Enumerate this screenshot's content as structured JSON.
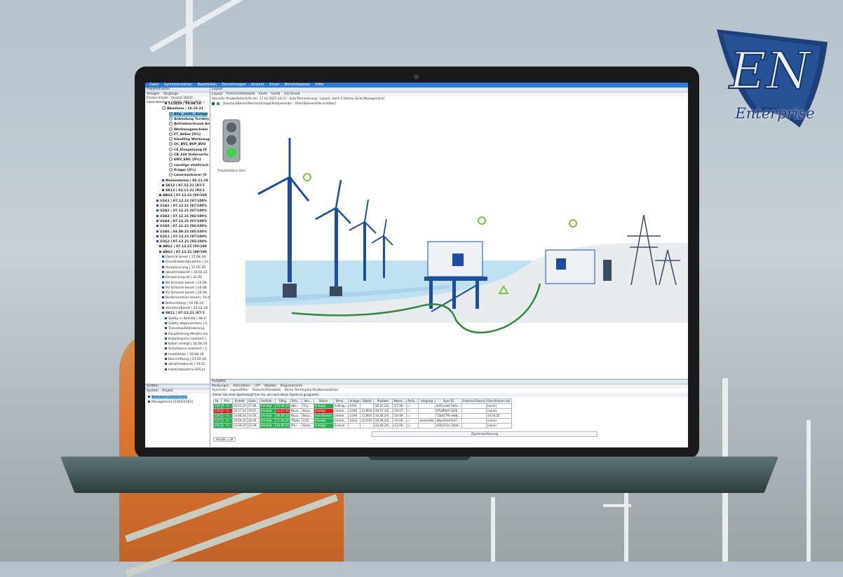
{
  "brand": {
    "logo_text": "Enterprise",
    "logo_mark": "EN",
    "colors": {
      "primary": "#1a3f7c",
      "menubar": "#2b7ed8",
      "ok": "#22b44a",
      "bad": "#e21c1c"
    }
  },
  "menu": [
    "Datei",
    "Synchronisation",
    "Bearbeiten",
    "Einstellungen",
    "Ansicht",
    "Email",
    "Berichtswesen",
    "Hilfe"
  ],
  "left": {
    "title": "Projektstruktur",
    "tabs": [
      "Anlagen",
      "Vorgänge"
    ],
    "info": "Einstes Anzahl - Gesamt:28522...",
    "path": "Inbetriebnahme | U1A2 | ABG1 | SK11 |",
    "tree": [
      {
        "t": "111820 | 16.08.18",
        "i": 28,
        "b": true,
        "k": "sq"
      },
      {
        "t": "Abnahme | 16.10.21",
        "i": 24,
        "b": true,
        "k": "circ"
      },
      {
        "t": "Allg._sicht._Anlage",
        "i": 34,
        "b": true,
        "k": "circ",
        "sel": true
      },
      {
        "t": "Anbindung Turnkey",
        "i": 34,
        "b": true,
        "k": "circ"
      },
      {
        "t": "Antriebsschrank An",
        "i": 34,
        "b": true,
        "k": "circ"
      },
      {
        "t": "Werkzeugwechsler",
        "i": 34,
        "b": true,
        "k": "circ"
      },
      {
        "t": "FT_Heber [0%]",
        "i": 34,
        "b": true,
        "k": "circ"
      },
      {
        "t": "Handling Werkzeug",
        "i": 34,
        "b": true,
        "k": "circ"
      },
      {
        "t": "OC_BVZ_BVP_BVO",
        "i": 34,
        "b": true,
        "k": "circ"
      },
      {
        "t": "CE_Einspeisung [0",
        "i": 34,
        "b": true,
        "k": "circ"
      },
      {
        "t": "CB_24V Unterverte",
        "i": 34,
        "b": true,
        "k": "circ"
      },
      {
        "t": "EMV_EMC [0%]",
        "i": 34,
        "b": true,
        "k": "circ"
      },
      {
        "t": "sonstige elektrisch",
        "i": 34,
        "b": true,
        "k": "circ"
      },
      {
        "t": "Präger [0%]",
        "i": 34,
        "b": true,
        "k": "circ"
      },
      {
        "t": "Lasermarkierer [0",
        "i": 34,
        "b": true,
        "k": "circ"
      },
      {
        "t": "Meilensteine | 05.11.19",
        "i": 24,
        "b": true,
        "k": "sq"
      },
      {
        "t": "SK12 | 07.12.21 [97/1",
        "i": 24,
        "b": true,
        "k": "sq"
      },
      {
        "t": "SK13 | 02.11.21 [93/1",
        "i": 24,
        "b": true,
        "k": "sq"
      },
      {
        "t": "ABG2 | 07.12.21 [95/100",
        "i": 20,
        "b": true,
        "k": "sq"
      },
      {
        "t": "U1G1 | 07.12.21 [97/100%",
        "i": 16,
        "b": true,
        "k": "sq"
      },
      {
        "t": "U1A1 | 07.12.21 [97/100%",
        "i": 16,
        "b": true,
        "k": "sq"
      },
      {
        "t": "U2A2 | 07.12.21 [97/100%",
        "i": 16,
        "b": true,
        "k": "sq"
      },
      {
        "t": "U2A3 | 07.12.21 [96/100%",
        "i": 16,
        "b": true,
        "k": "sq"
      },
      {
        "t": "U2A4 | 07.12.21 [97/100%",
        "i": 16,
        "b": true,
        "k": "sq"
      },
      {
        "t": "U2A5 | 07.12.21 [96/100%",
        "i": 16,
        "b": true,
        "k": "sq"
      },
      {
        "t": "U2A6 | 04.09.23 [95/100%",
        "i": 16,
        "b": true,
        "k": "sq"
      },
      {
        "t": "U2G1 | 07.12.21 [97/100%",
        "i": 16,
        "b": true,
        "k": "sq"
      },
      {
        "t": "U2G2 | 07.12.21 [95/100%",
        "i": 16,
        "b": true,
        "k": "sq"
      },
      {
        "t": "ABG1 | 07.12.21 [95/100",
        "i": 20,
        "b": true,
        "k": "sq"
      },
      {
        "t": "ABG2 | 07.12.21 [88/100",
        "i": 20,
        "b": true,
        "k": "sq"
      },
      {
        "t": "Elektrik bereit | 15.08.18",
        "i": 24,
        "b": false,
        "k": "sq"
      },
      {
        "t": "Grundinbetriebnahme | 14",
        "i": 24,
        "b": false,
        "k": "sq"
      },
      {
        "t": "Visualisierung | 11.02.20",
        "i": 24,
        "b": false,
        "k": "sq"
      },
      {
        "t": "abnahmebereit | 19.01.21",
        "i": 24,
        "b": false,
        "k": "sq"
      },
      {
        "t": "Einspeisung ok | 31.01.",
        "i": 24,
        "b": false,
        "k": "sq"
      },
      {
        "t": "BS Schrank bereit | 16.08.",
        "i": 24,
        "b": false,
        "k": "sq"
      },
      {
        "t": "SV Schrank bereit | 16.08.",
        "i": 24,
        "b": false,
        "k": "sq"
      },
      {
        "t": "KV Schrank bereit | 16.08.",
        "i": 24,
        "b": false,
        "k": "sq"
      },
      {
        "t": "Bedienrechner bereit | 16.0",
        "i": 24,
        "b": false,
        "k": "sq"
      },
      {
        "t": "Beleuchtung | 16.08.18",
        "i": 24,
        "b": false,
        "k": "sq"
      },
      {
        "t": "abnahmebereit | 23.02.18",
        "i": 24,
        "b": false,
        "k": "sq"
      },
      {
        "t": "SK21 | 07.12.21 [87/1",
        "i": 24,
        "b": true,
        "k": "sq"
      },
      {
        "t": "Safety in Betrieb | 08.0",
        "i": 28,
        "b": false,
        "k": "sq"
      },
      {
        "t": "Safety abgenommen | 0",
        "i": 28,
        "b": false,
        "k": "sq"
      },
      {
        "t": "Trassenaufständerung",
        "i": 28,
        "b": false,
        "k": "sq"
      },
      {
        "t": "Hauptleitung Medien mo",
        "i": 28,
        "b": false,
        "k": "sq"
      },
      {
        "t": "Kabeltrassen montiert |",
        "i": 28,
        "b": false,
        "k": "sq"
      },
      {
        "t": "Kabel verlegt | 16.08.18",
        "i": 28,
        "b": false,
        "k": "sq"
      },
      {
        "t": "Schutzzaun montiert | 1",
        "i": 28,
        "b": false,
        "k": "sq"
      },
      {
        "t": "Installation | 16.08.18",
        "i": 28,
        "b": false,
        "k": "sq"
      },
      {
        "t": "Beschriftung | 23.02.18",
        "i": 28,
        "b": false,
        "k": "sq"
      },
      {
        "t": "abnahmebereit | 23.02.",
        "i": 28,
        "b": false,
        "k": "sq"
      },
      {
        "t": "Inbetriebnahme SPS Je",
        "i": 28,
        "b": false,
        "k": "sq"
      }
    ],
    "sys_title": "Sichten",
    "sys_tabs": [
      "System",
      "Projekt"
    ],
    "sys_items": [
      "Technisch [2302/2302]",
      "Management [2302/2302]"
    ]
  },
  "layout": {
    "title": "Layout",
    "tabs": [
      "Layout",
      "Fortschrittstabelle",
      "Karte",
      "Gantt",
      "3-D Visual"
    ],
    "info": "Aktueller Projektfortschritt am: 17.04.2025 14:12 - Auto-Terminierung - Layout: Halle 2 [Aktive Sicht:Management]",
    "toolbar": "Overlay-Ebenen[Bereich|Anlage|Komponente] - Filter-Ebenen[Alle sichtbar]",
    "traffic_label": "Projektstatus Gesamt"
  },
  "bottom": {
    "title": "Ausgabe",
    "tabs": [
      "Meldungen",
      "Aktivitäten",
      "LOP",
      "Objekte",
      "Programminfo"
    ],
    "toolbar": [
      "Synchron",
      "Layoutfilter",
      "Fortschrittstabelle",
      "Keine Terminplan-Knotenselektion"
    ],
    "hint": "Ziehen Sie einen Spaltenkopf hier hin, um nach dieser Spalte zu gruppieren",
    "columns": [
      "Nr.",
      "Prio",
      "Erstellt",
      "Geän...",
      "Verfülle...",
      "Fällig",
      "Erfa...",
      "Ver...",
      "Status",
      "Berei...",
      "Anlage",
      "Objekt",
      "Problem",
      "Massn...",
      "Anha...",
      "Vorgang",
      "Sync-ID",
      "External Source",
      "Geschlossen am"
    ],
    "rows": [
      [
        "130",
        "0 - H...",
        "20.05.24",
        "27.06...",
        "Erledigt",
        "15.06.24",
        "HKa...",
        "TCo...",
        "Erledigt",
        "Auftrag...",
        "A1A1",
        "",
        "[30.05.24]...",
        "[27.06...",
        "☐",
        "",
        "dd51aaa0-5b6c...",
        "",
        "(none)"
      ],
      [
        "129",
        "1 - S...",
        "16.07.24",
        "19.07...",
        "Erledigt",
        "23.07.24",
        "NLuo...",
        "NLuo...",
        "Erledigt",
        "Unterb...",
        "U2A6",
        "113950",
        "[16.07.24]...",
        "[19.07...",
        "☐",
        "",
        "0f5e89c6-1b36...",
        "",
        "(none)"
      ],
      [
        "128",
        "1 - S...",
        "14.08.24",
        "16.04...",
        "Erledigt",
        "08.09.24",
        "NLuo...",
        "NLuo...",
        "Geschlossen",
        "Unterb...",
        "U2A6",
        "113950",
        "[14.08.24]...",
        "[10.09...",
        "☐",
        "",
        "72bb57f9-ce88...",
        "",
        "16.04.25"
      ],
      [
        "127",
        "1 - S...",
        "10.09.24",
        "16.04...",
        "Erledigt",
        "17.09.24",
        "TRpke",
        "CCD...",
        "Erledigt",
        "Unterb...",
        "U2G2",
        "213170",
        "[10.09.24]...",
        "[10.09...",
        "☐",
        "Automatik",
        "48ac91ed-fe47...",
        "",
        "(none)"
      ],
      [
        "103",
        "1 - S...",
        "23.09.24",
        "23.09...",
        "Erledigt",
        "30.09.24",
        "Pfru",
        "AAaz...",
        "Erledigt",
        "Einkauf",
        "",
        "",
        "[23.09.24]...",
        "[23.09...",
        "☑",
        "",
        "d44a713c-2db0...",
        "",
        "(none)"
      ]
    ],
    "row_colors": [
      [
        "g",
        "g",
        "",
        "",
        "g",
        "g",
        "",
        "",
        "g",
        "",
        "",
        "",
        "",
        "",
        "",
        "",
        "",
        "",
        ""
      ],
      [
        "r",
        "r",
        "",
        "",
        "g",
        "r",
        "",
        "",
        "r",
        "",
        "",
        "",
        "",
        "",
        "",
        "",
        "",
        "",
        ""
      ],
      [
        "g",
        "g",
        "",
        "",
        "g",
        "g",
        "",
        "",
        "g",
        "",
        "",
        "",
        "",
        "",
        "",
        "",
        "",
        "",
        ""
      ],
      [
        "g",
        "g",
        "",
        "",
        "g",
        "g",
        "",
        "",
        "g",
        "",
        "",
        "",
        "",
        "",
        "",
        "",
        "",
        "",
        ""
      ],
      [
        "g",
        "g",
        "",
        "",
        "g",
        "g",
        "",
        "",
        "g",
        "",
        "",
        "",
        "",
        "",
        "",
        "",
        "",
        "",
        ""
      ]
    ],
    "summary": "Zusammenfassung",
    "count": "Anzahl = 20"
  }
}
